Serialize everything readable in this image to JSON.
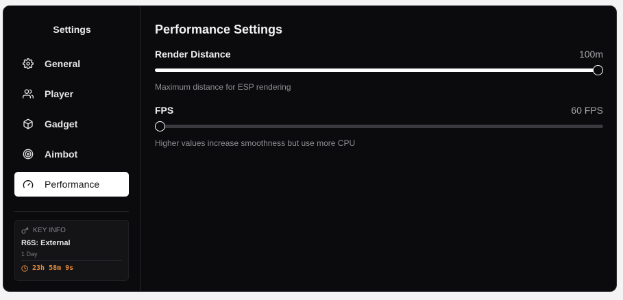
{
  "sidebar": {
    "title": "Settings",
    "items": [
      {
        "label": "General",
        "icon": "gear-icon",
        "active": false
      },
      {
        "label": "Player",
        "icon": "users-icon",
        "active": false
      },
      {
        "label": "Gadget",
        "icon": "box-icon",
        "active": false
      },
      {
        "label": "Aimbot",
        "icon": "target-icon",
        "active": false
      },
      {
        "label": "Performance",
        "icon": "gauge-icon",
        "active": true
      }
    ]
  },
  "key_info": {
    "heading": "KEY INFO",
    "icon": "key-icon",
    "product": "R6S: External",
    "duration": "1 Day",
    "timer_icon": "clock-icon",
    "time_remaining": "23h 58m 9s"
  },
  "main": {
    "title": "Performance Settings",
    "settings": [
      {
        "label": "Render Distance",
        "value": "100m",
        "description": "Maximum distance for ESP rendering",
        "fill_fraction": 1.0
      },
      {
        "label": "FPS",
        "value": "60 FPS",
        "description": "Higher values increase smoothness but use more CPU",
        "fill_fraction": 0.0
      }
    ]
  },
  "colors": {
    "background": "#0b0b0d",
    "accent": "#ffffff",
    "timer": "#e88a3c",
    "track": "#3a3a3e"
  }
}
